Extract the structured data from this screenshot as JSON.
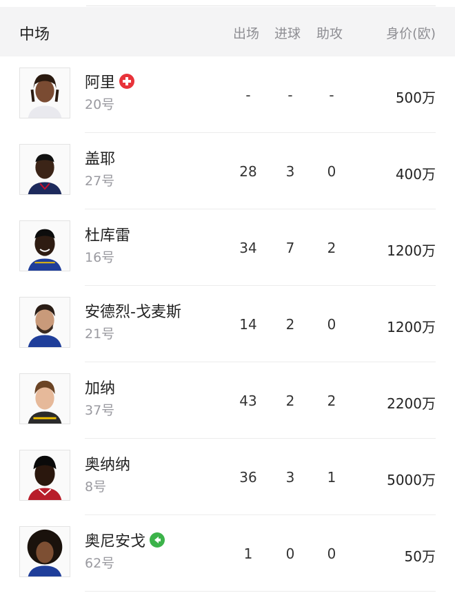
{
  "header": {
    "section": "中场",
    "col_apps": "出场",
    "col_goals": "进球",
    "col_assists": "助攻",
    "col_value": "身价(欧)"
  },
  "players": [
    {
      "name": "阿里",
      "number": "20号",
      "apps": "-",
      "goals": "-",
      "assists": "-",
      "value": "500万",
      "badge": "red-cross-icon"
    },
    {
      "name": "盖耶",
      "number": "27号",
      "apps": "28",
      "goals": "3",
      "assists": "0",
      "value": "400万",
      "badge": ""
    },
    {
      "name": "杜库雷",
      "number": "16号",
      "apps": "34",
      "goals": "7",
      "assists": "2",
      "value": "1200万",
      "badge": ""
    },
    {
      "name": "安德烈-戈麦斯",
      "number": "21号",
      "apps": "14",
      "goals": "2",
      "assists": "0",
      "value": "1200万",
      "badge": ""
    },
    {
      "name": "加纳",
      "number": "37号",
      "apps": "43",
      "goals": "2",
      "assists": "2",
      "value": "2200万",
      "badge": ""
    },
    {
      "name": "奥纳纳",
      "number": "8号",
      "apps": "36",
      "goals": "3",
      "assists": "1",
      "value": "5000万",
      "badge": ""
    },
    {
      "name": "奥尼安戈",
      "number": "62号",
      "apps": "1",
      "goals": "0",
      "assists": "0",
      "value": "50万",
      "badge": "green-arrow-icon"
    }
  ],
  "colors": {
    "header_bg": "#f4f4f5",
    "injury_badge": "#e8333a",
    "return_badge": "#3cb34a"
  }
}
